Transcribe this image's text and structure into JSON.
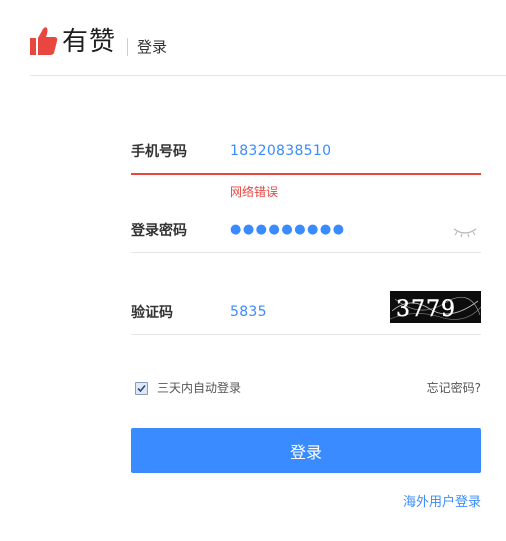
{
  "header": {
    "logo_text": "有赞",
    "title": "登录",
    "logo_icon": "thumbs-up-icon",
    "brand_color": "#e8463e"
  },
  "form": {
    "phone": {
      "label": "手机号码",
      "value": "18320838510",
      "error": "网络错误"
    },
    "password": {
      "label": "登录密码",
      "value": "●●●●●●●●●",
      "toggle_icon": "eye-closed-icon"
    },
    "captcha": {
      "label": "验证码",
      "value": "5835",
      "image_text": "3779"
    },
    "remember": {
      "label": "三天内自动登录",
      "checked": true
    },
    "forgot_label": "忘记密码?",
    "submit_label": "登录",
    "overseas_label": "海外用户登录"
  },
  "colors": {
    "accent": "#3a8bff",
    "error": "#e8463e"
  }
}
